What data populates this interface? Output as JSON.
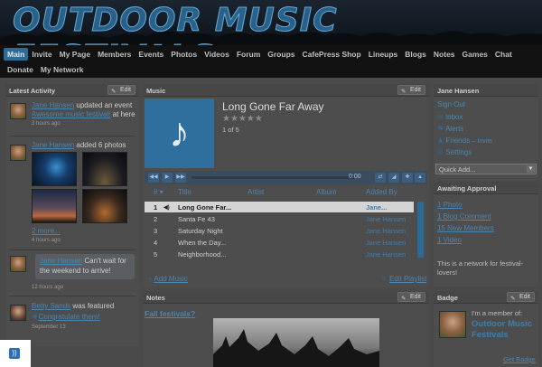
{
  "site": {
    "title": "OUTDOOR MUSIC FESTIVALS"
  },
  "nav": {
    "row1": [
      "Main",
      "Invite",
      "My Page",
      "Members",
      "Events",
      "Photos",
      "Videos",
      "Forum",
      "Groups",
      "CafePress Shop",
      "Lineups",
      "Blogs",
      "Notes",
      "Games",
      "Chat"
    ],
    "row2": [
      "Donate",
      "My Network"
    ],
    "active": "Main"
  },
  "latest": {
    "title": "Latest Activity",
    "edit": "Edit",
    "item1": {
      "user": "Jane Hansen",
      "action": "updated an event",
      "target": "Awesome music festival!",
      "suffix": "at here",
      "time": "3 hours ago"
    },
    "item2": {
      "user": "Jane Hansen",
      "action": "added 6 photos",
      "more": "2 more...",
      "time": "4 hours ago"
    },
    "item3": {
      "user": "Jane Hansen",
      "text1": "Can't wait for",
      "text2": "the weekend to arrive!",
      "time": "12 hours ago"
    },
    "item4": {
      "user": "Betty Sands",
      "action": "was featured",
      "link": "Congratulate them!",
      "time": "September 13"
    }
  },
  "music": {
    "title": "Music",
    "edit": "Edit",
    "now_title": "Long Gone Far Away",
    "stars": "★★★★★",
    "position": "1 of 5",
    "time": "0:00",
    "columns": [
      "# ▾",
      "Title",
      "Artist",
      "Album",
      "Added By"
    ],
    "tracks": [
      {
        "num": "1",
        "title": "Long Gone Far...",
        "by": "Jane..."
      },
      {
        "num": "2",
        "title": "Santa Fe 43",
        "by": "Jane Hansen"
      },
      {
        "num": "3",
        "title": "Saturday Night",
        "by": "Jane Hansen"
      },
      {
        "num": "4",
        "title": "When the Day...",
        "by": "Jane Hansen"
      },
      {
        "num": "5",
        "title": "Neighborhood...",
        "by": "Jane Hansen"
      }
    ],
    "add": "Add Music",
    "edit_playlist": "Edit Playlist"
  },
  "notes": {
    "title": "Notes",
    "edit": "Edit",
    "post": "Fall festivals?"
  },
  "user": {
    "name": "Jane Hansen",
    "sign_out": "Sign Out",
    "inbox": "Inbox",
    "alerts": "Alerts",
    "friends": "Friends",
    "invite": "Invite",
    "settings": "Settings",
    "quick_add": "Quick Add..."
  },
  "approval": {
    "title": "Awaiting Approval",
    "items": [
      "1 Photo",
      "1 Blog Comment",
      "15 New Members",
      "1 Video"
    ],
    "note1": "This is a network for festival-",
    "note2": "lovers!"
  },
  "badge": {
    "title": "Badge",
    "edit": "Edit",
    "member_of": "I'm a member of:",
    "network1": "Outdoor Music",
    "network2": "Festivals",
    "get": "Get Badge"
  },
  "colors": {
    "accent": "#2c6b95",
    "link": "#4b86b0",
    "album_art": "#2f6f9e"
  }
}
